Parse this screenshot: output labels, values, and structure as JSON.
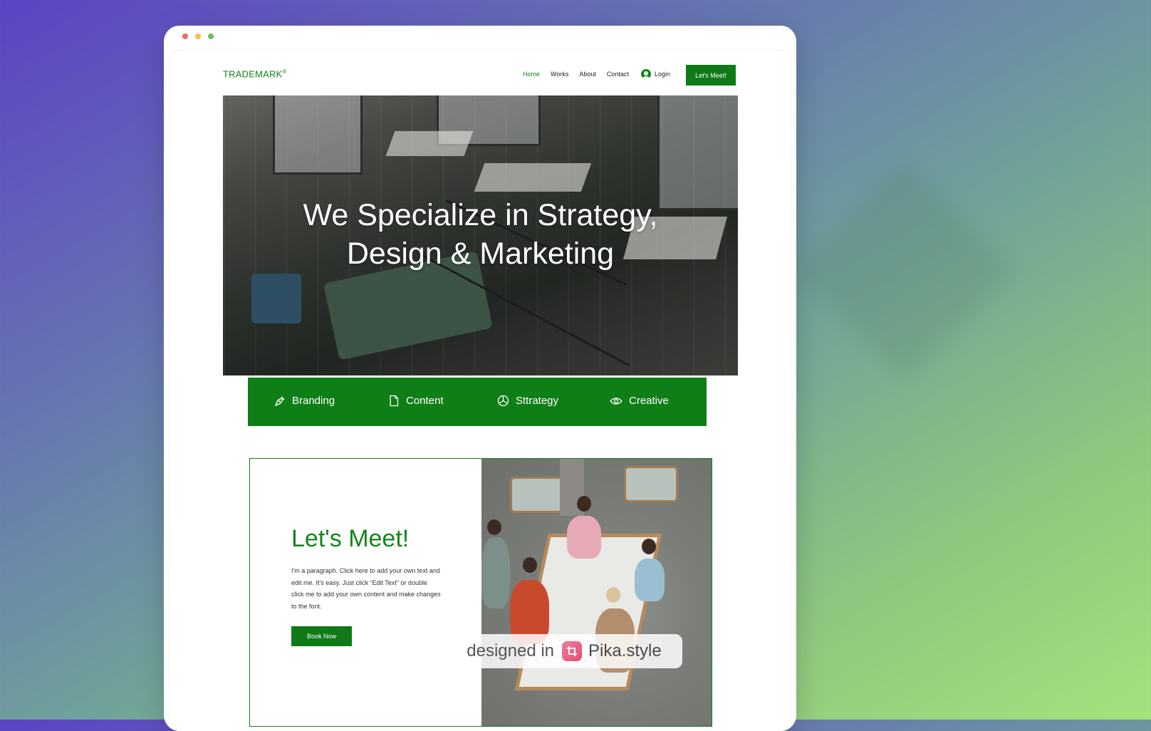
{
  "colors": {
    "brand_green": "#0f7e17",
    "text_green": "#12861d",
    "button_text": "#ffffff"
  },
  "header": {
    "logo": "TRADEMARK",
    "logo_mark": "®",
    "nav": [
      {
        "label": "Home",
        "active": true
      },
      {
        "label": "Works",
        "active": false
      },
      {
        "label": "About",
        "active": false
      },
      {
        "label": "Contact",
        "active": false
      }
    ],
    "login_label": "Login",
    "login_icon": "user-circle-icon",
    "cta_label": "Let's Meet!"
  },
  "hero": {
    "title_line1": "We Specialize in Strategy,",
    "title_line2": "Design & Marketing"
  },
  "services": [
    {
      "label": "Branding",
      "icon": "pen-nib-icon"
    },
    {
      "label": "Content",
      "icon": "document-icon"
    },
    {
      "label": "Sttrategy",
      "icon": "pie-chart-icon"
    },
    {
      "label": "Creative",
      "icon": "eye-icon"
    }
  ],
  "meet": {
    "title": "Let's Meet!",
    "paragraph": "I'm a paragraph. Click here to add your own text and edit me. It's easy. Just click “Edit Text” or double click me to add your own content and make changes to the font.",
    "button_label": "Book Now"
  },
  "watermark": {
    "prefix": "designed in",
    "brand": "Pika.style"
  }
}
